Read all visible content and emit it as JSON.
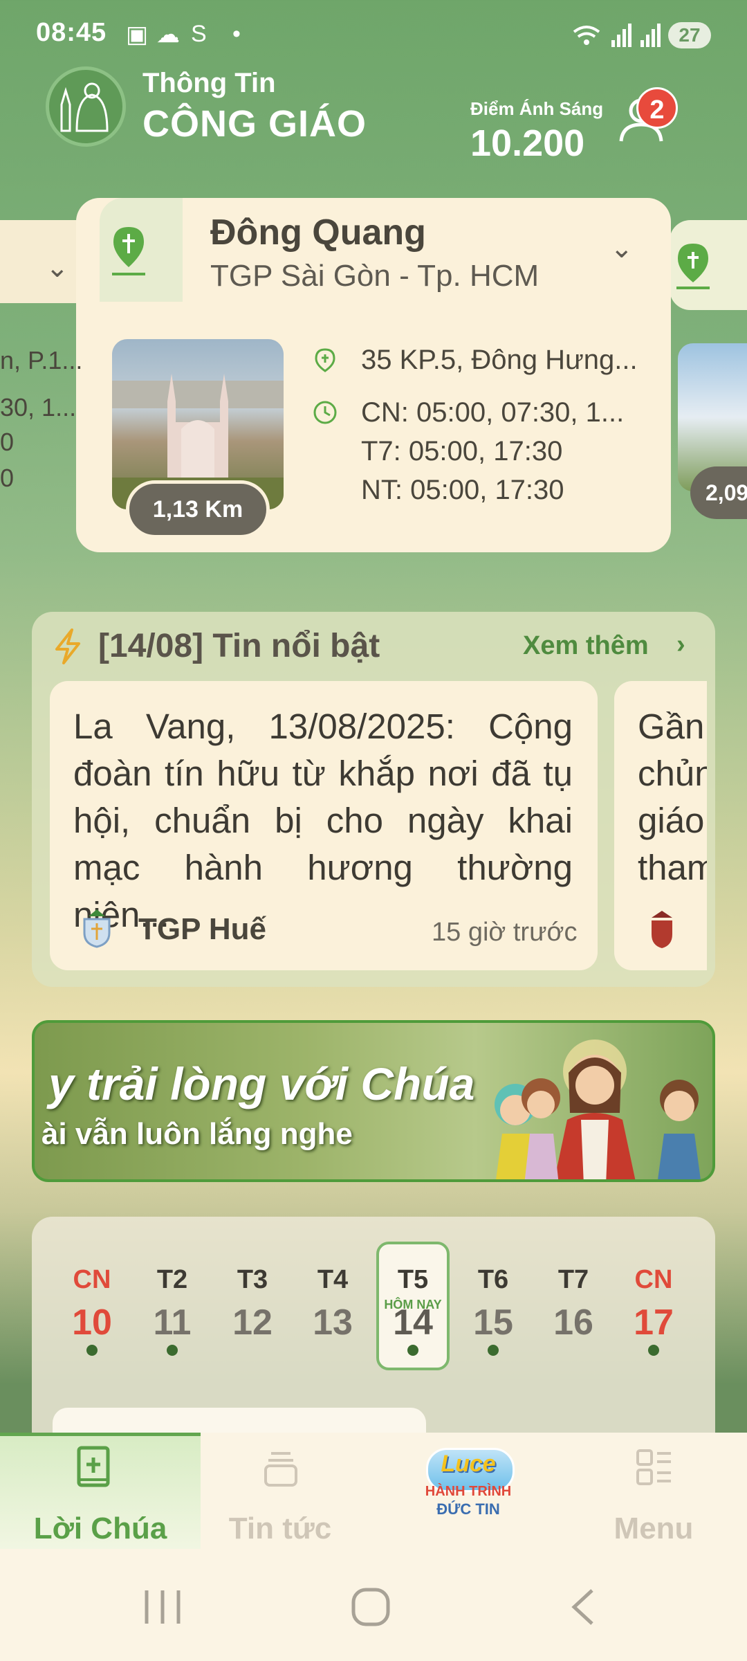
{
  "status_bar": {
    "time": "08:45",
    "battery": "27"
  },
  "header": {
    "brand_line1": "Thông Tin",
    "brand_line2": "CÔNG GIÁO",
    "points_label": "Điểm Ánh Sáng",
    "points_value": "10.200",
    "notification_count": "2"
  },
  "church": {
    "name": "Đông Quang",
    "diocese": "TGP Sài Gòn - Tp. HCM",
    "distance": "1,13 Km",
    "address": "35 KP.5, Đông Hưng...",
    "schedule_cn": "CN: 05:00, 07:30, 1...",
    "schedule_t7": "T7: 05:00, 17:30",
    "schedule_nt": "NT: 05:00, 17:30",
    "prev_peek": [
      "n, P.1...",
      "30, 1...",
      "0",
      "0"
    ],
    "next_distance_peek": "2,09"
  },
  "news": {
    "title": "[14/08]  Tin nổi bật",
    "more_label": "Xem thêm",
    "items": [
      {
        "text": "La Vang, 13/08/2025: Cộng đoàn tín hữu từ khắp nơi đã tụ hội, chuẩn bị cho ngày khai mạc hành hương thường niên...",
        "source": "TGP Huế",
        "time": "15 giờ trước"
      },
      {
        "text_lines": [
          "Gần",
          "chủn",
          "giáo",
          "tham"
        ]
      }
    ]
  },
  "banner": {
    "line1": "y trải lòng với Chúa",
    "line2": "ài vẫn luôn lắng nghe"
  },
  "calendar": {
    "days": [
      {
        "dow": "CN",
        "num": "10",
        "dot": true
      },
      {
        "dow": "T2",
        "num": "11",
        "dot": true
      },
      {
        "dow": "T3",
        "num": "12",
        "dot": false
      },
      {
        "dow": "T4",
        "num": "13",
        "dot": false
      },
      {
        "dow": "T5",
        "num": "14",
        "dot": true
      },
      {
        "dow": "T6",
        "num": "15",
        "dot": true
      },
      {
        "dow": "T7",
        "num": "16",
        "dot": false
      },
      {
        "dow": "CN",
        "num": "17",
        "dot": true
      }
    ],
    "today_label": "HÔM NAY"
  },
  "bottom_nav": {
    "items": [
      {
        "label": "Lời Chúa",
        "icon": "bible-icon",
        "active": true
      },
      {
        "label": "Tin tức",
        "icon": "stack-icon",
        "active": false
      },
      {
        "label": "",
        "icon": "luce-logo",
        "active": false
      },
      {
        "label": "Menu",
        "icon": "grid-list-icon",
        "active": false
      }
    ],
    "logo_text": [
      "Luce",
      "HÀNH TRÌNH",
      "ĐỨC TIN"
    ]
  },
  "colors": {
    "primary_green": "#62a64f",
    "accent_red": "#e04a3a",
    "card_bg": "#fbf1da",
    "header_bg": "#6fa66a"
  }
}
